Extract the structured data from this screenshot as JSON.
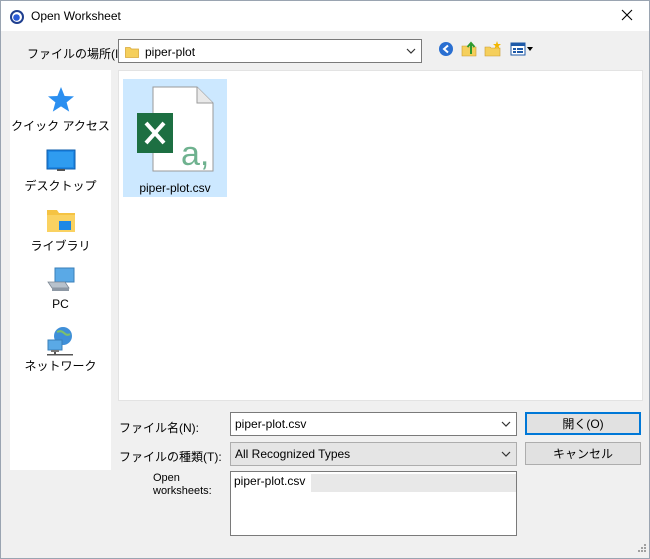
{
  "window": {
    "title": "Open Worksheet",
    "close_glyph": "✕"
  },
  "location": {
    "label": "ファイルの場所(I):",
    "value": "piper-plot"
  },
  "toolbar": {
    "back_icon": "back-icon",
    "up_icon": "up-folder-icon",
    "new_folder_icon": "new-folder-icon",
    "view_menu_icon": "view-menu-icon"
  },
  "places": [
    {
      "label": "クイック アクセス",
      "icon": "quick-access-icon"
    },
    {
      "label": "デスクトップ",
      "icon": "desktop-icon"
    },
    {
      "label": "ライブラリ",
      "icon": "library-icon"
    },
    {
      "label": "PC",
      "icon": "pc-icon"
    },
    {
      "label": "ネットワーク",
      "icon": "network-icon"
    }
  ],
  "files": [
    {
      "name": "piper-plot.csv",
      "icon": "excel-csv-icon",
      "selected": true
    }
  ],
  "form": {
    "filename_label": "ファイル名(N):",
    "filename_value": "piper-plot.csv",
    "filetype_label": "ファイルの種類(T):",
    "filetype_value": "All Recognized Types",
    "open_button": "開く(O)",
    "cancel_button": "キャンセル",
    "open_worksheets_label_line1": "Open",
    "open_worksheets_label_line2": "worksheets:",
    "open_worksheets": [
      "piper-plot.csv"
    ]
  },
  "colors": {
    "selection": "#cce8ff",
    "excel_green": "#1d6f42",
    "accent": "#0078d7"
  }
}
